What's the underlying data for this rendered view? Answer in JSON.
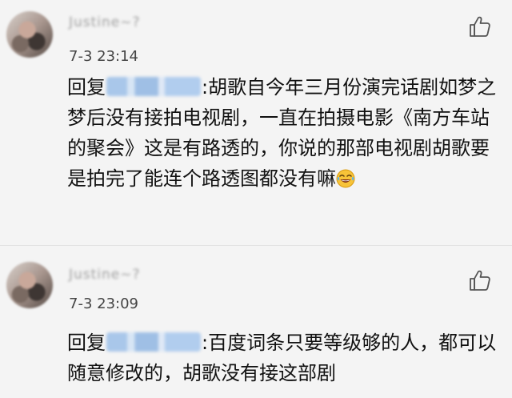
{
  "comments": [
    {
      "username": "Justine~?",
      "timestamp": "7-3 23:14",
      "reply_prefix": "回复",
      "mention": "@...",
      "text": ":胡歌自今年三月份演完话剧如梦之梦后没有接拍电视剧，一直在拍摄电影《南方车站的聚会》这是有路透的，你说的那部电视剧胡歌要是拍完了能连个路透图都没有嘛",
      "emoji": "laughing-tears-emoji"
    },
    {
      "username": "Justine~?",
      "timestamp": "7-3 23:09",
      "reply_prefix": "回复",
      "mention": "@...",
      "text": ":百度词条只要等级够的人，都可以随意修改的，胡歌没有接这部剧"
    }
  ],
  "icons": {
    "like": "thumbs-up-icon"
  },
  "colors": {
    "background": "#f4f4f4",
    "meta_text": "#444444",
    "mention_blur": "#a9c7ea"
  }
}
